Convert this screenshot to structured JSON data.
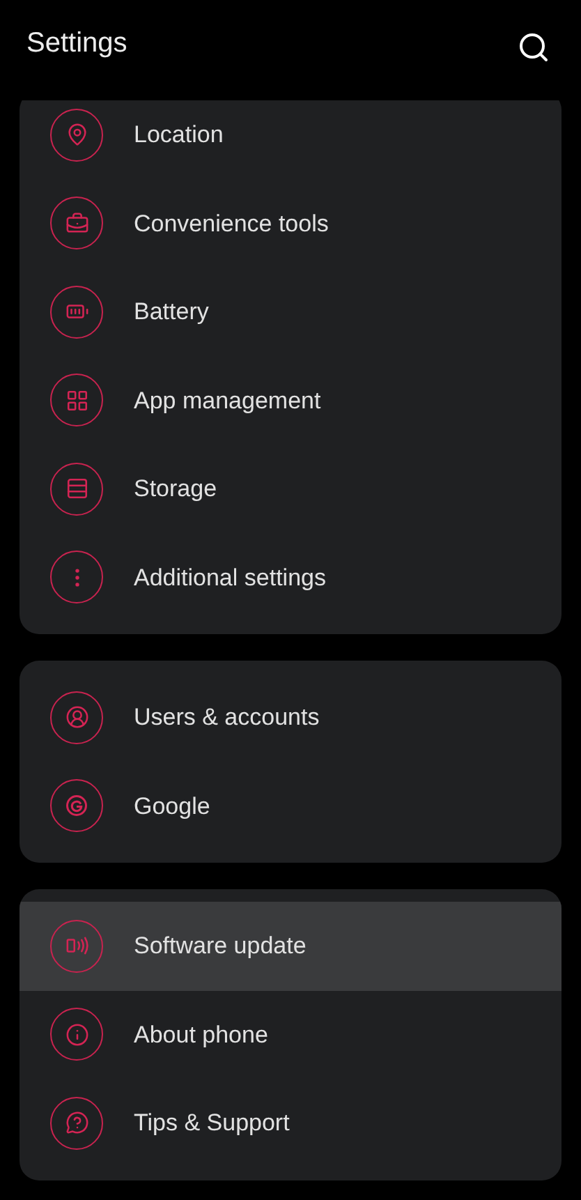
{
  "header": {
    "title": "Settings"
  },
  "groups": [
    {
      "items": [
        {
          "label": "Location",
          "selected": false
        },
        {
          "label": "Convenience tools",
          "selected": false
        },
        {
          "label": "Battery",
          "selected": false
        },
        {
          "label": "App management",
          "selected": false
        },
        {
          "label": "Storage",
          "selected": false
        },
        {
          "label": "Additional settings",
          "selected": false
        }
      ]
    },
    {
      "items": [
        {
          "label": "Users & accounts",
          "selected": false
        },
        {
          "label": "Google",
          "selected": false
        }
      ]
    },
    {
      "items": [
        {
          "label": "Software update",
          "selected": true
        },
        {
          "label": "About phone",
          "selected": false
        },
        {
          "label": "Tips & Support",
          "selected": false
        }
      ]
    }
  ]
}
